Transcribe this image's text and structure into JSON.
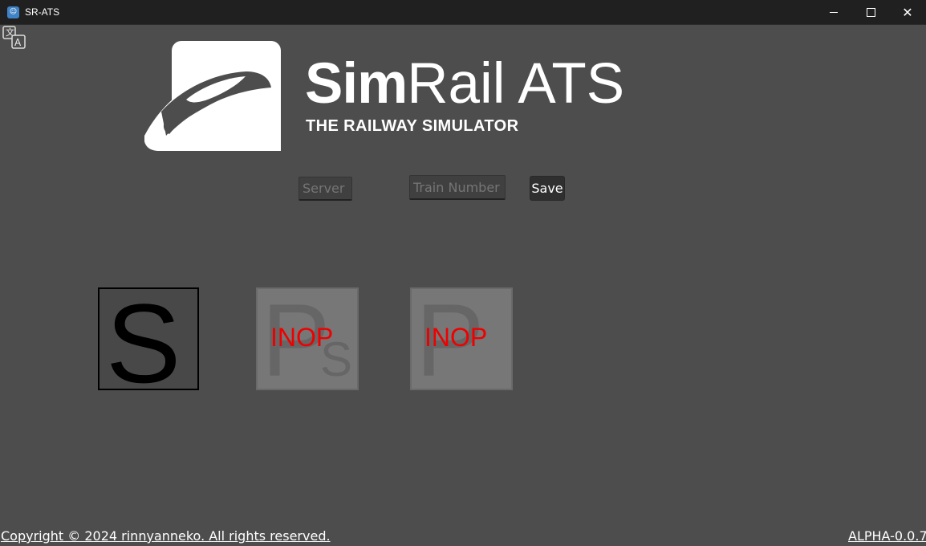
{
  "window": {
    "title": "SR-ATS",
    "icon": "game-engine-app-icon"
  },
  "titlebar": {
    "minimize_icon": "minimize-icon",
    "maximize_icon": "maximize-icon",
    "close_icon": "close-icon"
  },
  "language_toggle": {
    "icon": "translate-icon"
  },
  "logo": {
    "title_bold": "Sim",
    "title_regular": "Rail ATS",
    "subtitle": "THE RAILWAY SIMULATOR",
    "icon": "train-logo-icon"
  },
  "connection": {
    "server_placeholder": "Server",
    "train_placeholder": "Train Number",
    "save_label": "Save"
  },
  "indicators": [
    {
      "letter": "S",
      "status": "",
      "background": "#484848"
    },
    {
      "letter": "P",
      "sub": "S",
      "status": "INOP",
      "background": "#777777"
    },
    {
      "letter": "P",
      "status": "INOP",
      "background": "#777777"
    }
  ],
  "footer": {
    "copyright": "Copyright © 2024 rinnyanneko. All rights reserved.",
    "version": "ALPHA-0.0.7"
  },
  "colors": {
    "background": "#4d4d4d",
    "titlebar": "#202020",
    "inop": "#ee0000"
  }
}
